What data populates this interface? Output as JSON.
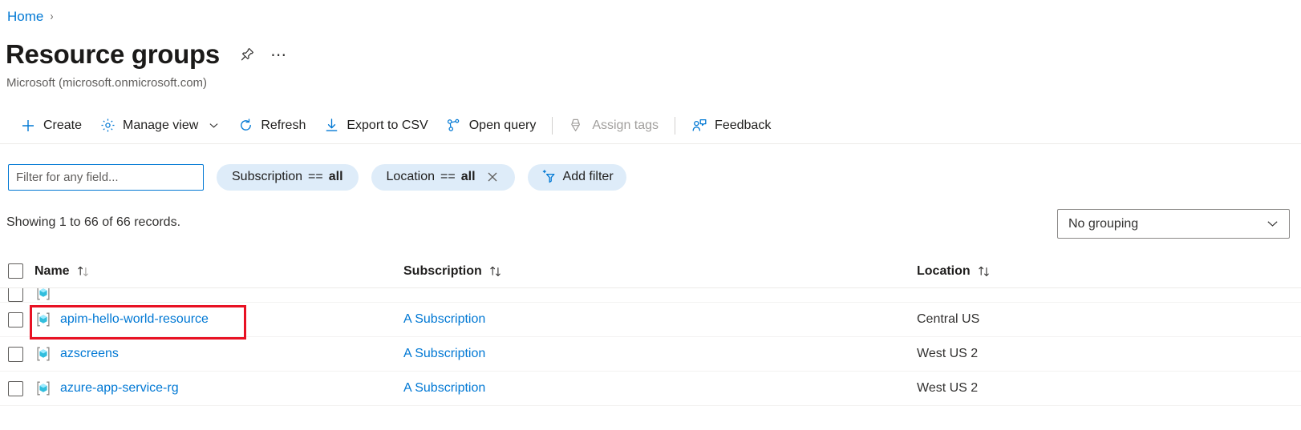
{
  "breadcrumb": {
    "home": "Home",
    "separator": "›"
  },
  "header": {
    "title": "Resource groups",
    "subtitle": "Microsoft (microsoft.onmicrosoft.com)",
    "pin_icon": "pin-icon",
    "more_icon": "ellipsis-icon"
  },
  "toolbar": {
    "create_label": "Create",
    "manage_view_label": "Manage view",
    "refresh_label": "Refresh",
    "export_csv_label": "Export to CSV",
    "open_query_label": "Open query",
    "assign_tags_label": "Assign tags",
    "feedback_label": "Feedback",
    "accent_color": "#0078d4",
    "disabled_color": "#a19f9d"
  },
  "filters": {
    "search_placeholder": "Filter for any field...",
    "search_value": "",
    "pills": [
      {
        "field": "Subscription",
        "operator": "==",
        "value": "all",
        "removable": false
      },
      {
        "field": "Location",
        "operator": "==",
        "value": "all",
        "removable": true
      }
    ],
    "add_filter_label": "Add filter",
    "pill_background": "#deecf9"
  },
  "results": {
    "records_text": "Showing 1 to 66 of 66 records.",
    "grouping_value": "No grouping"
  },
  "table": {
    "columns": [
      {
        "label": "Name",
        "sortable": true
      },
      {
        "label": "Subscription",
        "sortable": true
      },
      {
        "label": "Location",
        "sortable": true
      }
    ],
    "rows": [
      {
        "name": "apim-hello-world-resource",
        "subscription": "A Subscription",
        "location": "Central US",
        "highlighted": true
      },
      {
        "name": "azscreens",
        "subscription": "A Subscription",
        "location": "West US 2",
        "highlighted": false
      },
      {
        "name": "azure-app-service-rg",
        "subscription": "A Subscription",
        "location": "West US 2",
        "highlighted": false
      }
    ],
    "link_color": "#0078d4",
    "highlight_color": "#e81123"
  }
}
